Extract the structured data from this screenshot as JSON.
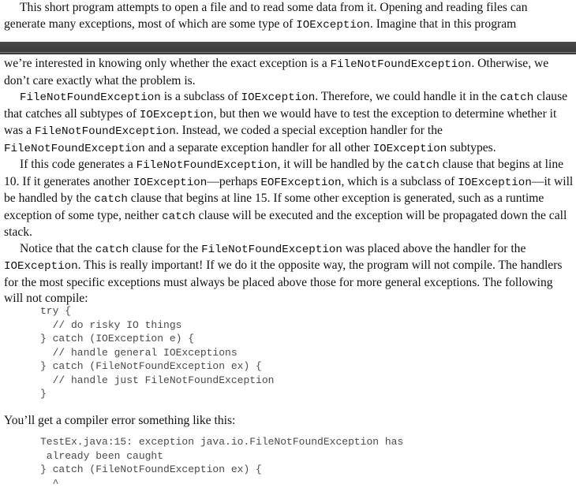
{
  "top_para": {
    "line1": "This short program attempts to open a file and to read some data from it. Opening and reading files can",
    "line2_a": "generate many exceptions, most of which are some type of ",
    "line2_code": "IOException",
    "line2_b": ". Imagine that in this program"
  },
  "p1": {
    "a": "we’re interested in knowing only whether the exact exception is a ",
    "c1": "FileNotFoundException",
    "b": ". Otherwise, we don’t care exactly what the problem is."
  },
  "p2": {
    "c1": "FileNotFoundException",
    "a": " is a subclass of ",
    "c2": "IOException",
    "b": ". Therefore, we could handle it in the ",
    "c3": "catch",
    "c": " clause that catches all subtypes of ",
    "c4": "IOException",
    "d": ", but then we would have to test the exception to determine whether it was a ",
    "c5": "FileNotFoundException",
    "e": ". Instead, we coded a special exception handler for the ",
    "c6": "FileNotFoundException",
    "f": " and a separate exception handler for all other ",
    "c7": "IOException",
    "g": " subtypes."
  },
  "p3": {
    "a": "If this code generates a ",
    "c1": "FileNotFoundException",
    "b": ", it will be handled by the ",
    "c2": "catch",
    "c": " clause that begins at line 10. If it generates another ",
    "c3": "IOException",
    "d": "—perhaps ",
    "c4": "EOFException",
    "e": ", which is a subclass of ",
    "c5": "IOException",
    "f": "—it will be handled by the ",
    "c6": "catch",
    "g": " clause that begins at line 15. If some other exception is generated, such as a runtime exception of some type, neither ",
    "c7": "catch",
    "h": " clause will be executed and the exception will be propagated down the call stack."
  },
  "p4": {
    "a": "Notice that the ",
    "c1": "catch",
    "b": " clause for the ",
    "c2": "FileNotFoundException",
    "c": " was placed above the handler for the ",
    "c3": "IOException",
    "d": ". This is really important! If we do it the opposite way, the program will not compile. The handlers for the most specific exceptions must always be placed above those for more general exceptions. The following will not compile:"
  },
  "code1": "try {\n  // do risky IO things\n} catch (IOException e) {\n  // handle general IOExceptions\n} catch (FileNotFoundException ex) {\n  // handle just FileNotFoundException\n}",
  "after_text": "You’ll get a compiler error something like this:",
  "code2": "TestEx.java:15: exception java.io.FileNotFoundException has\n already been caught\n} catch (FileNotFoundException ex) {\n  ^"
}
